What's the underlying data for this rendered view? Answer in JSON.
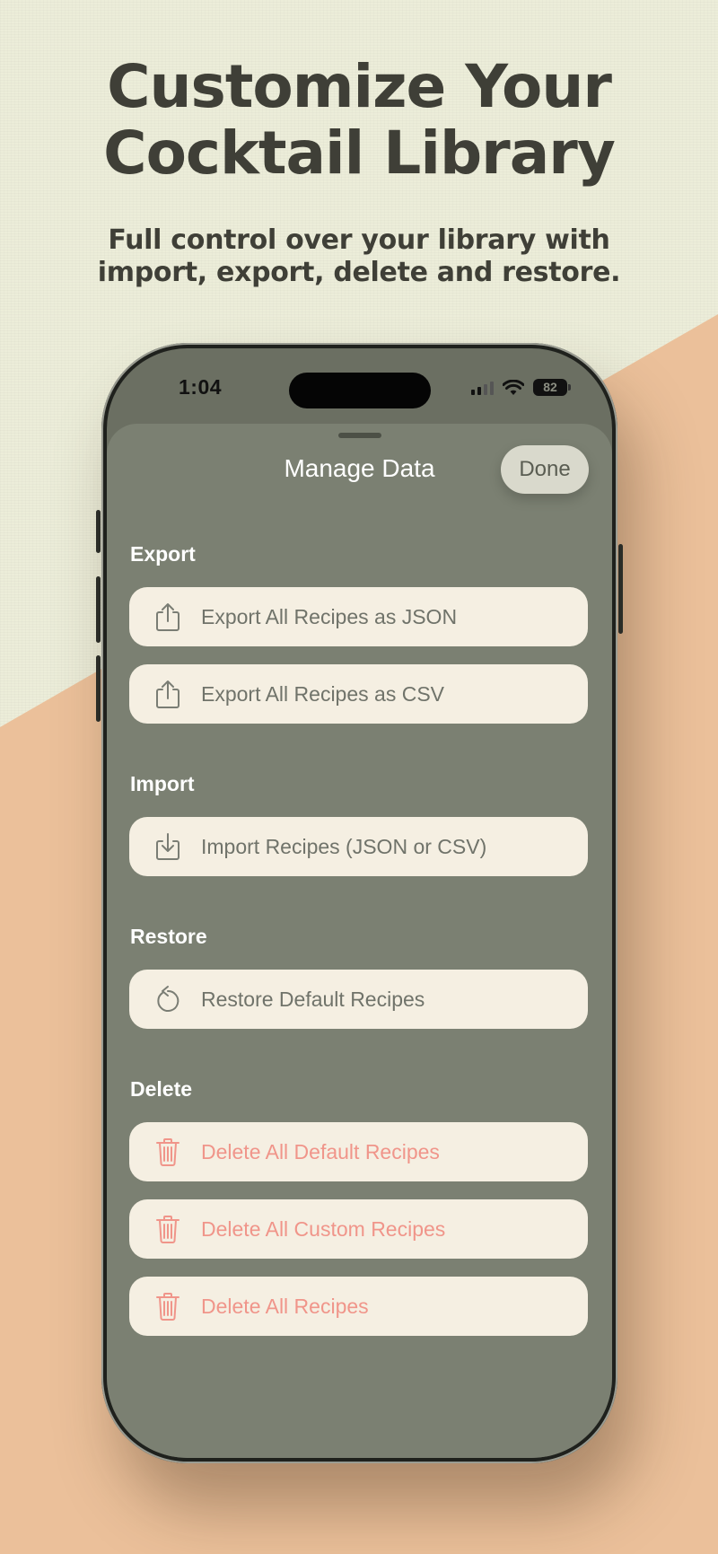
{
  "promo": {
    "title_line1": "Customize Your",
    "title_line2": "Cocktail Library",
    "subtitle_line1": "Full control over your library with",
    "subtitle_line2": "import, export, delete and restore."
  },
  "status_bar": {
    "time": "1:04",
    "battery": "82"
  },
  "sheet": {
    "title": "Manage Data",
    "done_label": "Done"
  },
  "sections": {
    "export": {
      "heading": "Export",
      "items": [
        {
          "label": "Export All Recipes as JSON",
          "icon": "share-icon"
        },
        {
          "label": "Export All Recipes as CSV",
          "icon": "share-icon"
        }
      ]
    },
    "import": {
      "heading": "Import",
      "items": [
        {
          "label": "Import Recipes (JSON or CSV)",
          "icon": "download-tray-icon"
        }
      ]
    },
    "restore": {
      "heading": "Restore",
      "items": [
        {
          "label": "Restore Default Recipes",
          "icon": "restore-arrow-icon"
        }
      ]
    },
    "delete": {
      "heading": "Delete",
      "items": [
        {
          "label": "Delete All Default Recipes",
          "icon": "trash-icon"
        },
        {
          "label": "Delete All Custom Recipes",
          "icon": "trash-icon"
        },
        {
          "label": "Delete All Recipes",
          "icon": "trash-icon"
        }
      ]
    }
  },
  "colors": {
    "sheet_bg": "#7b8072",
    "row_bg": "#f5efe2",
    "text_muted": "#70736a",
    "danger": "#f0958a",
    "headline": "#3f3f37",
    "peach_bg": "#ebc09a"
  }
}
